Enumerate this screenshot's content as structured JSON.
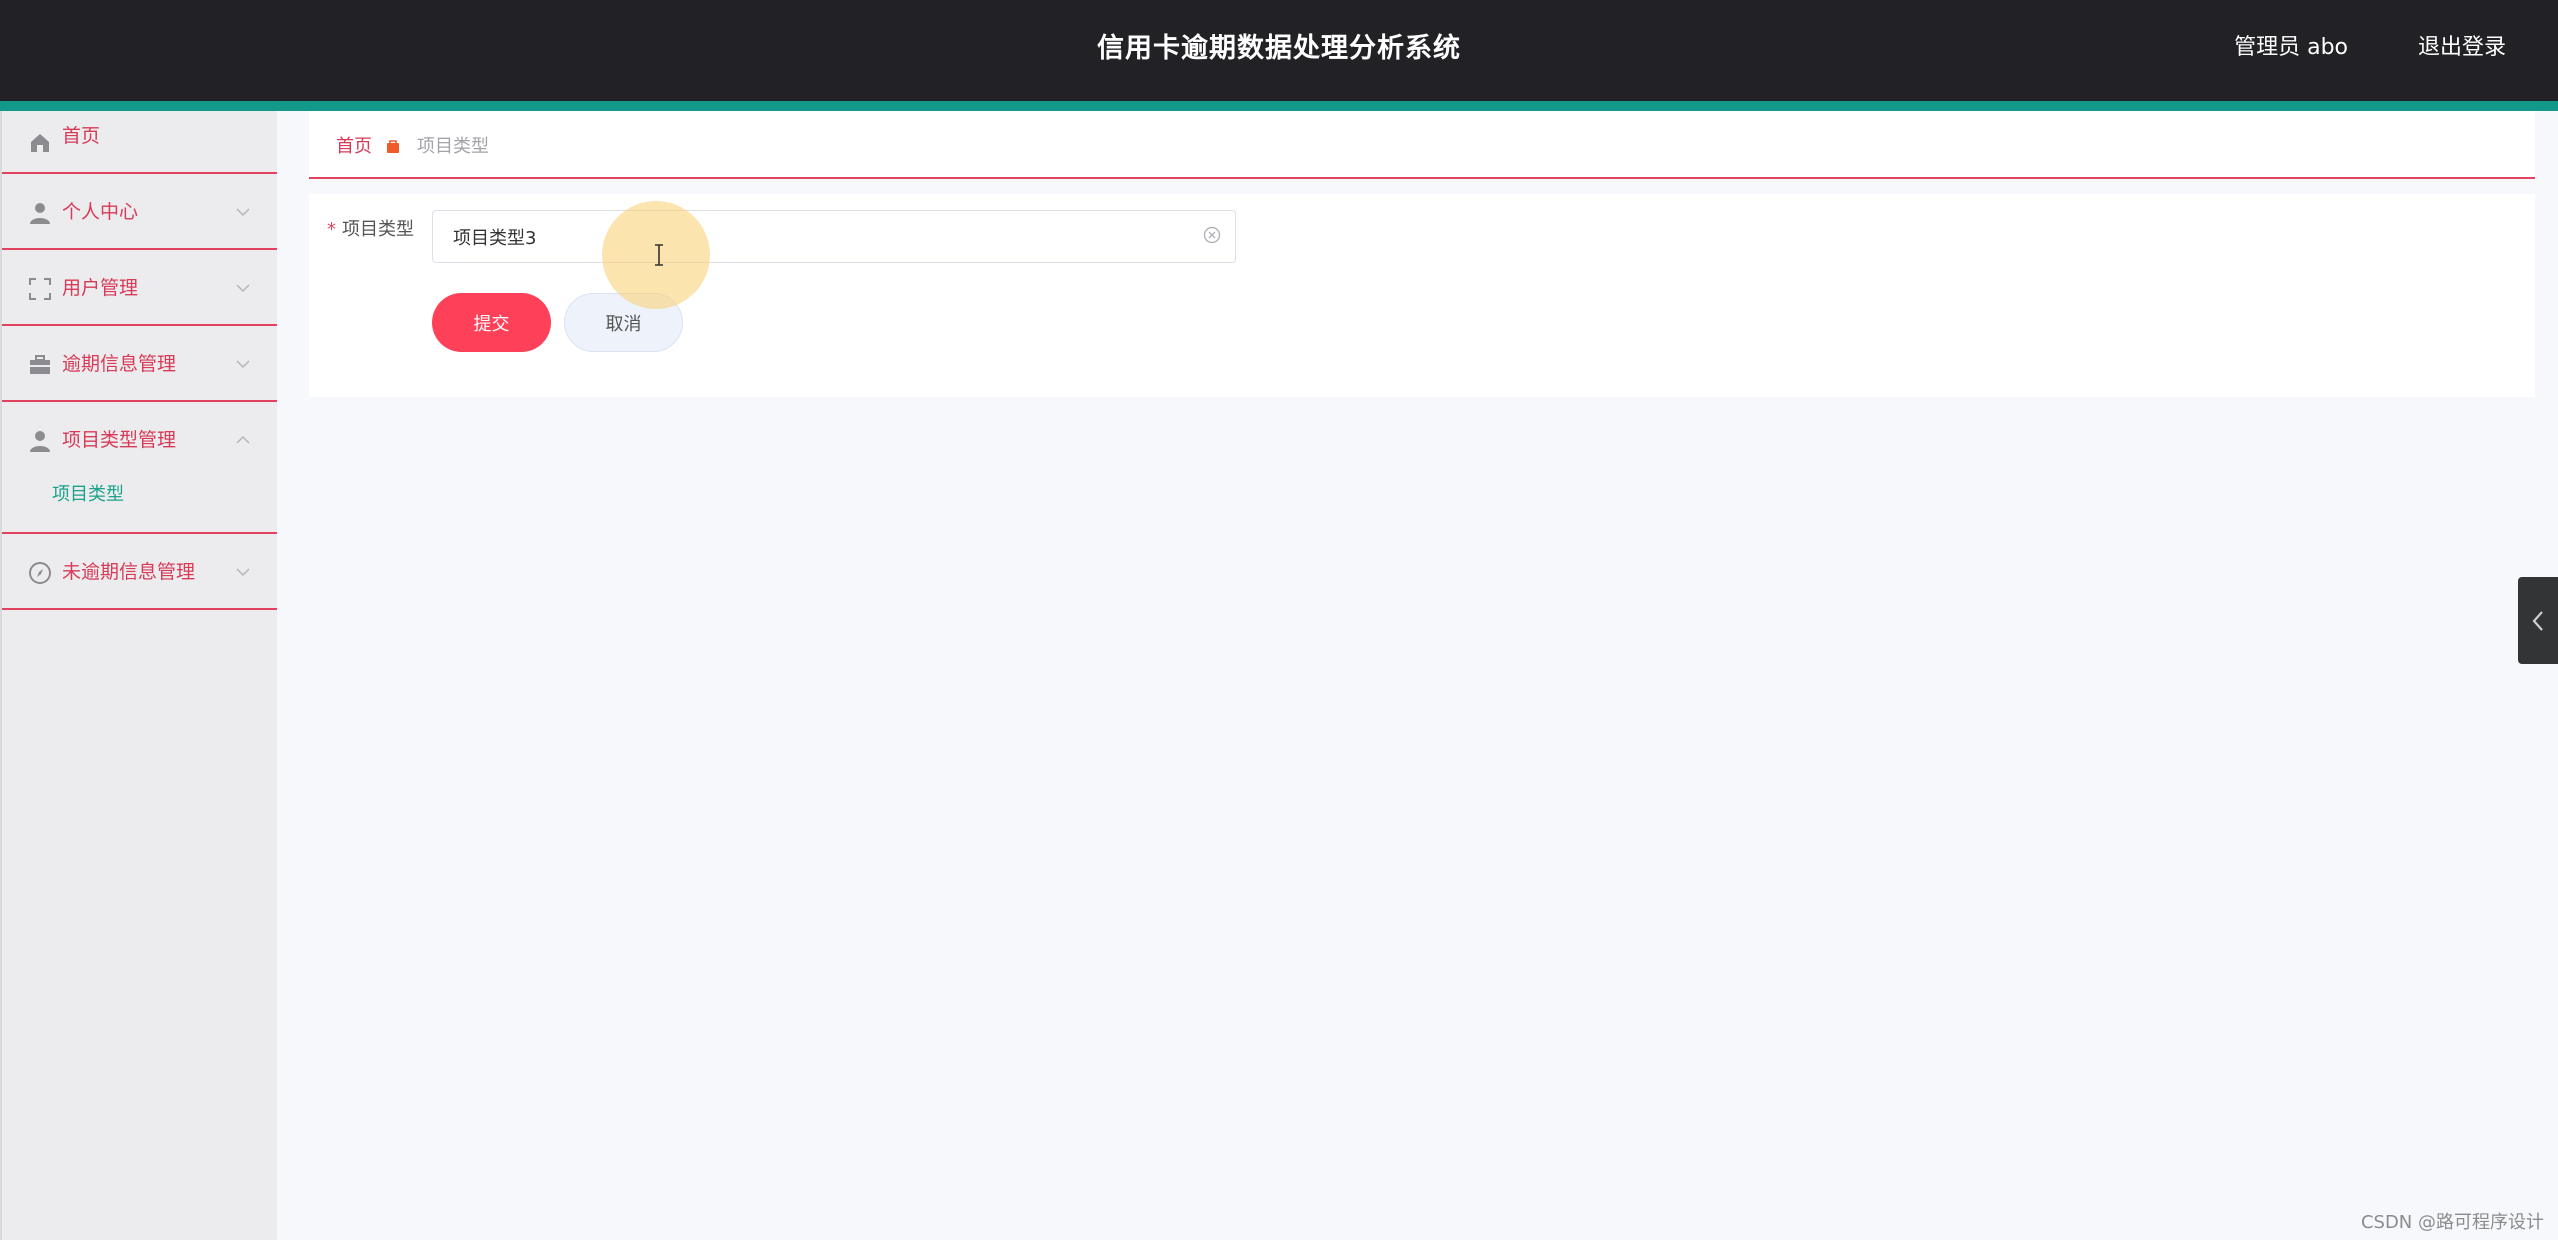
{
  "header": {
    "title": "信用卡逾期数据处理分析系统",
    "user": "管理员 abo",
    "logout_label": "退出登录"
  },
  "sidebar": {
    "items": [
      {
        "label": "首页",
        "icon": "home-icon"
      },
      {
        "label": "个人中心",
        "icon": "user-icon"
      },
      {
        "label": "用户管理",
        "icon": "frame-icon"
      },
      {
        "label": "逾期信息管理",
        "icon": "briefcase-icon"
      },
      {
        "label": "项目类型管理",
        "icon": "user-icon"
      },
      {
        "label": "未逾期信息管理",
        "icon": "compass-icon"
      }
    ],
    "submenu": {
      "label": "项目类型"
    }
  },
  "breadcrumb": {
    "home": "首页",
    "current": "项目类型"
  },
  "form": {
    "field_label": "项目类型",
    "required_mark": "*",
    "field_value": "项目类型3",
    "submit_label": "提交",
    "cancel_label": "取消"
  },
  "colors": {
    "header_bg": "#222226",
    "accent_teal": "#13998a",
    "menu_text": "#d83a58",
    "submenu_text": "#1aa389",
    "submit_bg": "#fe4159"
  },
  "watermark": "CSDN @路可程序设计"
}
